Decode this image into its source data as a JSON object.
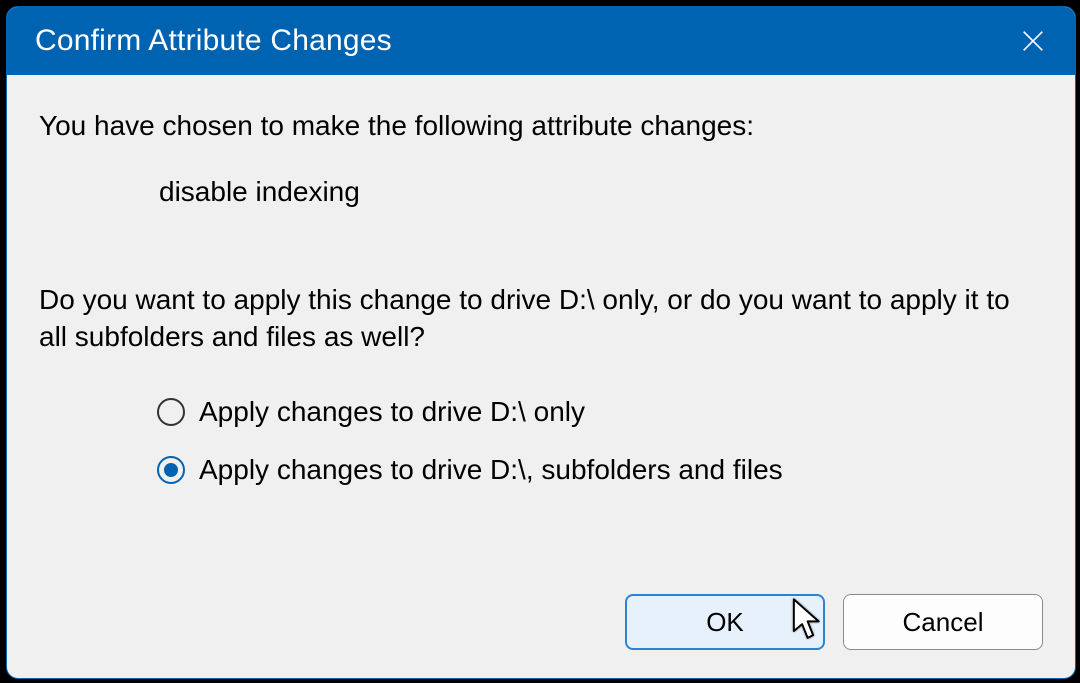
{
  "titlebar": {
    "title": "Confirm Attribute Changes"
  },
  "content": {
    "intro": "You have chosen to make the following attribute changes:",
    "change": "disable indexing",
    "question": "Do you want to apply this change to drive D:\\ only, or do you want to apply it to all subfolders and files as well?"
  },
  "options": {
    "opt1": {
      "label": "Apply changes to drive D:\\ only",
      "selected": false
    },
    "opt2": {
      "label": "Apply changes to drive D:\\, subfolders and files",
      "selected": true
    }
  },
  "buttons": {
    "ok": "OK",
    "cancel": "Cancel"
  }
}
